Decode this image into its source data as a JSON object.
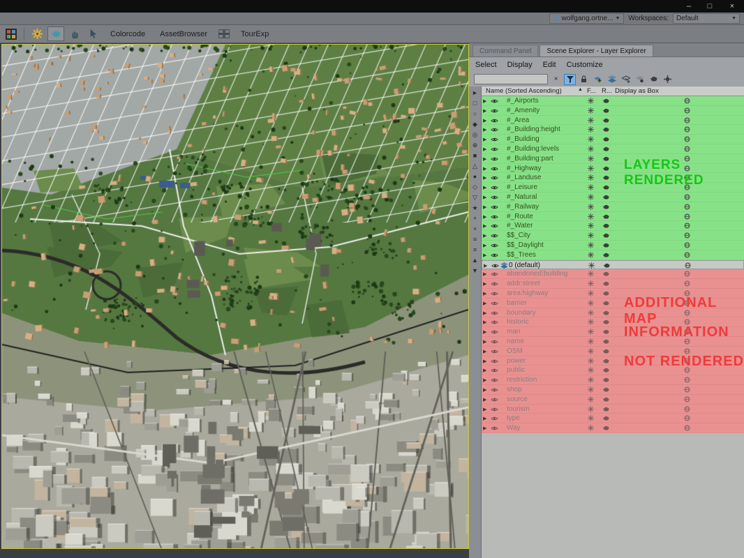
{
  "titlebar": {
    "minimize": "–",
    "maximize": "□",
    "close": "×"
  },
  "userbar": {
    "username": "wolfgang.ortne...",
    "dropdown_arrow": "▼",
    "workspaces_label": "Workspaces:",
    "workspace_value": "Default"
  },
  "toolbar": {
    "colorcode": "Colorcode",
    "assetbrowser": "AssetBrowser",
    "tourexp": "TourExp"
  },
  "panel": {
    "tab_command": "Command Panel",
    "tab_scene": "Scene Explorer - Layer Explorer",
    "menu": [
      "Select",
      "Display",
      "Edit",
      "Customize"
    ],
    "search_clear": "×",
    "header": {
      "name": "Name (Sorted Ascending)",
      "sort_arrow": "▲",
      "frozen": "F...",
      "render": "R...",
      "display": "Display as Box"
    },
    "layers_rendered": [
      "#_Airports",
      "#_Amenity",
      "#_Area",
      "#_Building:height",
      "#_Building",
      "#_Building:levels",
      "#_Building:part",
      "#_Highway",
      "#_Landuse",
      "#_Leisure",
      "#_Natural",
      "#_Railway",
      "#_Route",
      "#_Water",
      "$$_City",
      "$$_Daylight",
      "$$_Trees"
    ],
    "layer_default": "0 (default)",
    "layers_not_rendered": [
      "abandoned:building",
      "addr:street",
      "area:highway",
      "barrier",
      "boundary",
      "historic",
      "man",
      "name",
      "OSM",
      "power",
      "public",
      "restriction",
      "shop",
      "source",
      "tourism",
      "type",
      "Way"
    ],
    "annotation_rendered": "LAYERS RENDERED",
    "annotation_not_rendered": [
      "ADDITIONAL MAP",
      "INFORMATION",
      "NOT RENDERED"
    ],
    "colors": {
      "rendered_bg": "#87e287",
      "not_rendered_bg": "#e99191",
      "default_bg": "#c6cac6",
      "annotation_green": "#17c517",
      "annotation_red": "#ef3b3b"
    },
    "filter_glyphs": [
      "►",
      "□",
      "○",
      "◆",
      "◎",
      "⊕",
      "■",
      "△",
      "●",
      "◇",
      "▽",
      "★",
      "+",
      "×",
      "≡",
      "¤",
      "▲",
      "▼"
    ]
  }
}
